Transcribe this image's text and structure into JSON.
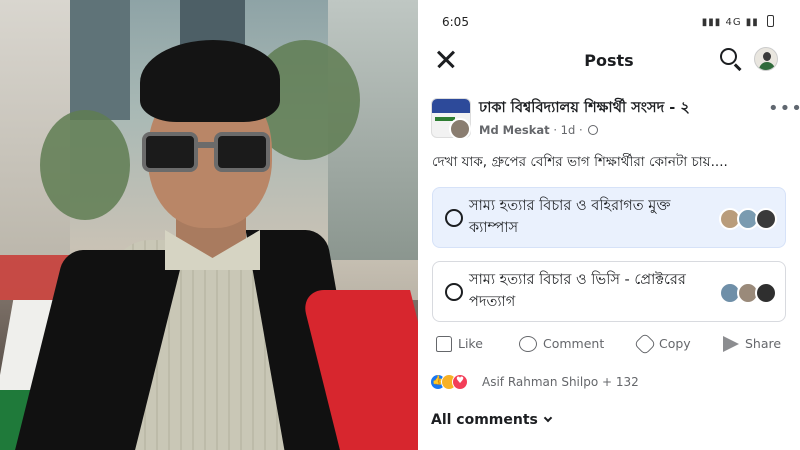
{
  "status_bar": {
    "time": "6:05",
    "network": "4G"
  },
  "header": {
    "title": "Posts"
  },
  "post": {
    "group_name": "ঢাকা বিশ্ববিদ্যালয় শিক্ষার্থী সংসদ - ২",
    "author": "Md Meskat",
    "time": "1d",
    "text": "দেখা যাক, গ্রুপের বেশির ভাগ শিক্ষার্থীরা কোনটা চায়....",
    "poll_options": [
      {
        "label": "সাম্য হত্যার বিচার ও বহিরাগত মুক্ত ক্যাম্পাস"
      },
      {
        "label": "সাম্য হত্যার বিচার ও ভিসি - প্রোক্টরের পদত্যাগ"
      }
    ]
  },
  "actions": {
    "like": "Like",
    "comment": "Comment",
    "copy": "Copy",
    "share": "Share"
  },
  "reactions": {
    "text": "Asif Rahman Shilpo + 132"
  },
  "comments": {
    "label": "All comments"
  },
  "colors": {
    "fb_blue": "#1877f2",
    "poll_selected_bg": "#eaf1fd",
    "love": "#f33e58",
    "haha": "#f7b125"
  },
  "icons": [
    "close-icon",
    "search-icon",
    "more-icon",
    "globe-icon",
    "like-icon",
    "comment-icon",
    "copy-icon",
    "share-icon",
    "chevron-down-icon"
  ]
}
